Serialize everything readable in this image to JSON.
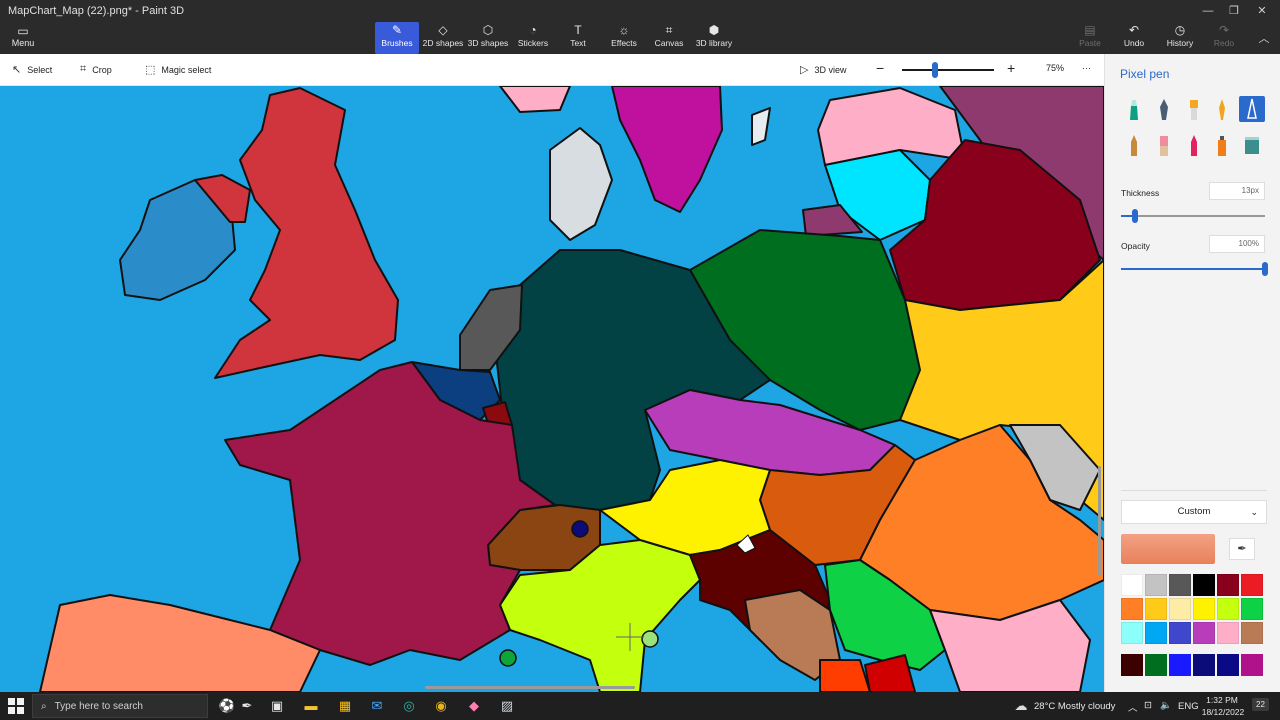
{
  "window": {
    "title": "MapChart_Map (22).png* - Paint 3D"
  },
  "ribbon": {
    "menu_label": "Menu",
    "tools": [
      {
        "label": "Brushes",
        "icon": "brush-icon",
        "active": true
      },
      {
        "label": "2D shapes",
        "icon": "shapes-2d-icon"
      },
      {
        "label": "3D shapes",
        "icon": "shapes-3d-icon"
      },
      {
        "label": "Stickers",
        "icon": "sticker-icon"
      },
      {
        "label": "Text",
        "icon": "text-icon"
      },
      {
        "label": "Effects",
        "icon": "effects-icon"
      },
      {
        "label": "Canvas",
        "icon": "canvas-icon"
      },
      {
        "label": "3D library",
        "icon": "library-3d-icon"
      }
    ],
    "right_tools": [
      {
        "label": "Paste",
        "icon": "paste-icon",
        "disabled": true
      },
      {
        "label": "Undo",
        "icon": "undo-icon"
      },
      {
        "label": "History",
        "icon": "history-icon"
      },
      {
        "label": "Redo",
        "icon": "redo-icon",
        "disabled": true
      }
    ]
  },
  "subbar": {
    "select": "Select",
    "crop": "Crop",
    "magic_select": "Magic select",
    "view_3d": "3D view",
    "zoom": "75%",
    "more": "···"
  },
  "panel": {
    "title": "Pixel pen",
    "thickness_label": "Thickness",
    "thickness_value": "13px",
    "thickness_level": 0.1,
    "opacity_label": "Opacity",
    "opacity_value": "100%",
    "opacity_level": 1.0,
    "color_mode": "Custom",
    "current_color": "#e8815a",
    "palette": [
      "#ffffff",
      "#c3c3c3",
      "#585858",
      "#000000",
      "#88001b",
      "#ec1c24",
      "#ff7f27",
      "#ffca18",
      "#fdeca6",
      "#fff200",
      "#c4ff0e",
      "#0ed145",
      "#8cfffb",
      "#00a8f3",
      "#3f48cc",
      "#b83dba",
      "#ffaec8",
      "#b97a56"
    ],
    "custom_palette": [
      "#3b0000",
      "#006e1f",
      "#1a1aff",
      "#0b0b7a",
      "#0a0a86",
      "#b0128c"
    ]
  },
  "taskbar": {
    "search_placeholder": "Type here to search",
    "weather": "28°C  Mostly cloudy",
    "language": "ENG",
    "time": "1:32 PM",
    "date": "18/12/2022",
    "notifications": "22"
  }
}
